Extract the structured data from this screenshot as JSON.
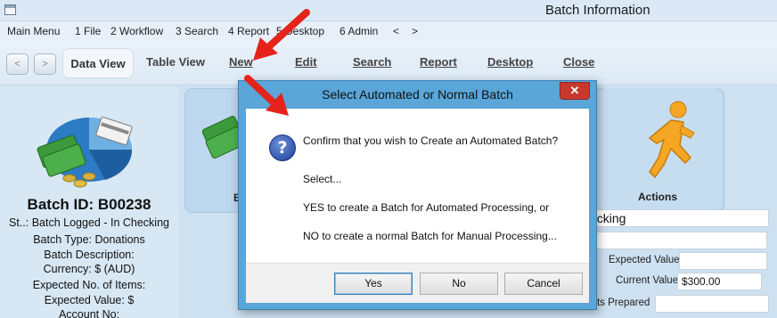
{
  "window": {
    "title": "Batch Information"
  },
  "menu": [
    "Main Menu",
    "1 File",
    "2 Workflow",
    "3 Search",
    "4 Report",
    "5 Desktop",
    "6 Admin",
    "<",
    ">"
  ],
  "toolbar": {
    "back": "<",
    "forward": ">",
    "items": [
      "Data View",
      "Table View",
      "New",
      "Edit",
      "Search",
      "Report",
      "Desktop",
      "Close"
    ]
  },
  "batch": {
    "id_line": "Batch ID: B00238",
    "status_line": "St..: Batch Logged - In Checking",
    "type_line": "Batch Type: Donations",
    "description_line": "Batch Description:",
    "currency_line": "Currency: $ (AUD)",
    "expected_items_line": "Expected No. of Items:",
    "expected_value_line": "Expected Value: $",
    "account_line": "Account No:"
  },
  "main": {
    "fragment_label": "B",
    "actions_label": "Actions",
    "status_field": "ecking",
    "expected_value_label": "Expected Value",
    "current_value_label": "Current Value",
    "current_value": "$300.00",
    "receipts_label": "ipts Prepared"
  },
  "dialog": {
    "title": "Select Automated or Normal Batch",
    "close": "✕",
    "question": "Confirm that you wish to Create an Automated Batch?",
    "select": "Select...",
    "yes_text": "YES to create a Batch for Automated Processing, or",
    "no_text": "NO to create a normal Batch for Manual Processing...",
    "buttons": {
      "yes": "Yes",
      "no": "No",
      "cancel": "Cancel"
    }
  },
  "colors": {
    "arrow": "#e5231b",
    "accent": "#5aa6d8"
  }
}
